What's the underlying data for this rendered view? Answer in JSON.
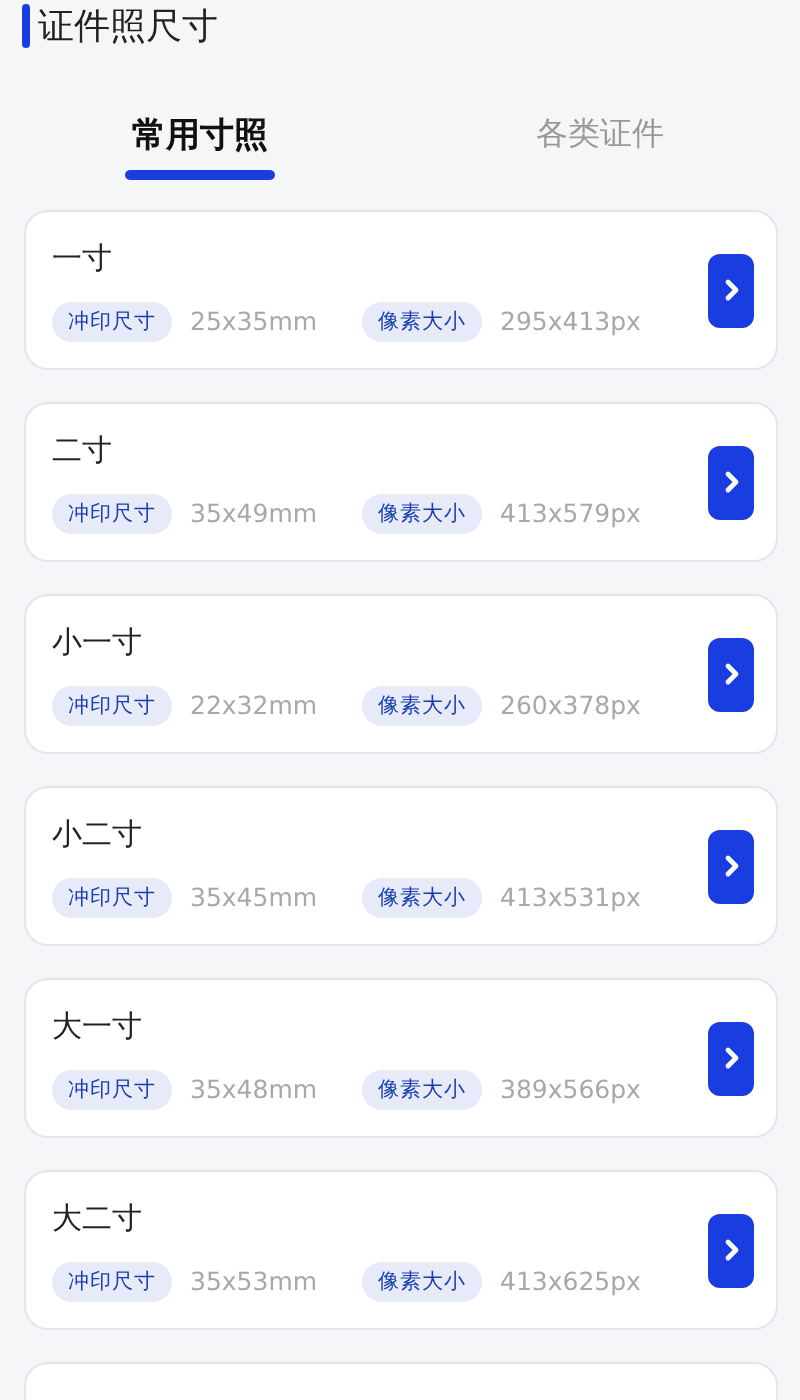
{
  "header": {
    "title": "证件照尺寸"
  },
  "tabs": [
    {
      "label": "常用寸照",
      "selected": true
    },
    {
      "label": "各类证件",
      "selected": false
    }
  ],
  "sizes": [
    {
      "name": "一寸",
      "print_label": "冲印尺寸",
      "print_size": "25x35mm",
      "pixel_label": "像素大小",
      "pixel_size": "295x413px"
    },
    {
      "name": "二寸",
      "print_label": "冲印尺寸",
      "print_size": "35x49mm",
      "pixel_label": "像素大小",
      "pixel_size": "413x579px"
    },
    {
      "name": "小一寸",
      "print_label": "冲印尺寸",
      "print_size": "22x32mm",
      "pixel_label": "像素大小",
      "pixel_size": "260x378px"
    },
    {
      "name": "小二寸",
      "print_label": "冲印尺寸",
      "print_size": "35x45mm",
      "pixel_label": "像素大小",
      "pixel_size": "413x531px"
    },
    {
      "name": "大一寸",
      "print_label": "冲印尺寸",
      "print_size": "35x48mm",
      "pixel_label": "像素大小",
      "pixel_size": "389x566px"
    },
    {
      "name": "大二寸",
      "print_label": "冲印尺寸",
      "print_size": "35x53mm",
      "pixel_label": "像素大小",
      "pixel_size": "413x625px"
    }
  ]
}
